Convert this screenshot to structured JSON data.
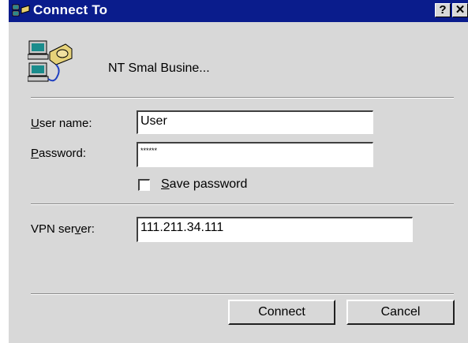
{
  "window": {
    "title": "Connect To",
    "help_glyph": "?",
    "close_glyph": "✕",
    "title_icon": "network-connection-icon",
    "accent_color": "#0a1c8c",
    "face_color": "#d8d8d8"
  },
  "connection": {
    "icon": "dial-up-computers-icon",
    "name": "NT Smal Busine..."
  },
  "form": {
    "user_label_accel": "U",
    "user_label_rest": "ser name:",
    "user_value": "User",
    "password_label_accel": "P",
    "password_label_rest": "assword:",
    "password_value": "******",
    "save_password_accel": "S",
    "save_password_rest": "ave password",
    "save_password_checked": false,
    "vpn_label_pre": "VPN ser",
    "vpn_label_accel": "v",
    "vpn_label_post": "er:",
    "vpn_value": "111.211.34.111"
  },
  "buttons": {
    "connect": "Connect",
    "cancel": "Cancel"
  }
}
